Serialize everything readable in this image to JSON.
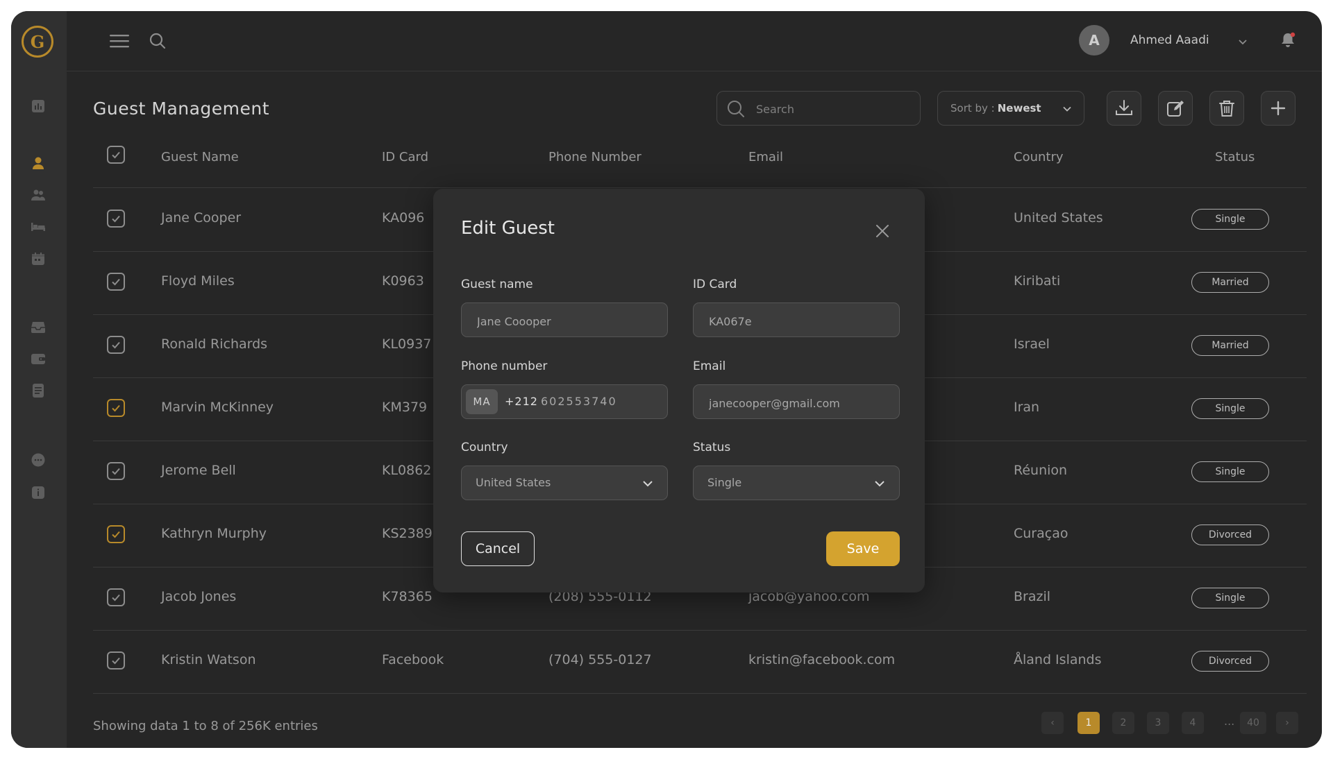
{
  "app": {
    "logo_letter": "G",
    "accent": "#c8962e"
  },
  "header": {
    "user_initial": "A",
    "user_name": "Ahmed Aaadi"
  },
  "page": {
    "title": "Guest Management",
    "search_placeholder": "Search",
    "sort_label": "Sort by :",
    "sort_value": "Newest"
  },
  "table": {
    "headers": [
      "Guest Name",
      "ID Card",
      "Phone Number",
      "Email",
      "Country",
      "Status"
    ],
    "rows": [
      {
        "name": "Jane Cooper",
        "id": "KA096",
        "phone": "",
        "email": "",
        "country": "United States",
        "status": "Single",
        "checked_accent": false
      },
      {
        "name": "Floyd Miles",
        "id": "K0963",
        "phone": "",
        "email": "",
        "country": "Kiribati",
        "status": "Married",
        "checked_accent": false
      },
      {
        "name": "Ronald Richards",
        "id": "KL0937",
        "phone": "",
        "email": "",
        "country": "Israel",
        "status": "Married",
        "checked_accent": false
      },
      {
        "name": "Marvin McKinney",
        "id": "KM379",
        "phone": "",
        "email": "",
        "country": "Iran",
        "status": "Single",
        "checked_accent": true
      },
      {
        "name": "Jerome Bell",
        "id": "KL0862",
        "phone": "",
        "email": "",
        "country": "Réunion",
        "status": "Single",
        "checked_accent": false
      },
      {
        "name": "Kathryn Murphy",
        "id": "KS2389",
        "phone": "",
        "email": "",
        "country": "Curaçao",
        "status": "Divorced",
        "checked_accent": true
      },
      {
        "name": "Jacob Jones",
        "id": "K78365",
        "phone": "(208) 555-0112",
        "email": "jacob@yahoo.com",
        "country": "Brazil",
        "status": "Single",
        "checked_accent": false
      },
      {
        "name": "Kristin Watson",
        "id": "Facebook",
        "phone": "(704) 555-0127",
        "email": "kristin@facebook.com",
        "country": "Åland Islands",
        "status": "Divorced",
        "checked_accent": false
      }
    ]
  },
  "footer": {
    "summary": "Showing data 1 to 8 of  256K entries",
    "pages": [
      "1",
      "2",
      "3",
      "4",
      "...",
      "40"
    ],
    "prev": "‹",
    "next": "›"
  },
  "modal": {
    "title": "Edit Guest",
    "guest_name_label": "Guest name",
    "guest_name_value": "Jane Coooper",
    "id_card_label": "ID Card",
    "id_card_value": "KA067e",
    "phone_label": "Phone number",
    "phone_country_code": "MA",
    "phone_dial": "+212",
    "phone_value": "602553740",
    "email_label": "Email",
    "email_value": "janecooper@gmail.com",
    "country_label": "Country",
    "country_value": "United States",
    "status_label": "Status",
    "status_value": "Single",
    "cancel_label": "Cancel",
    "save_label": "Save"
  }
}
